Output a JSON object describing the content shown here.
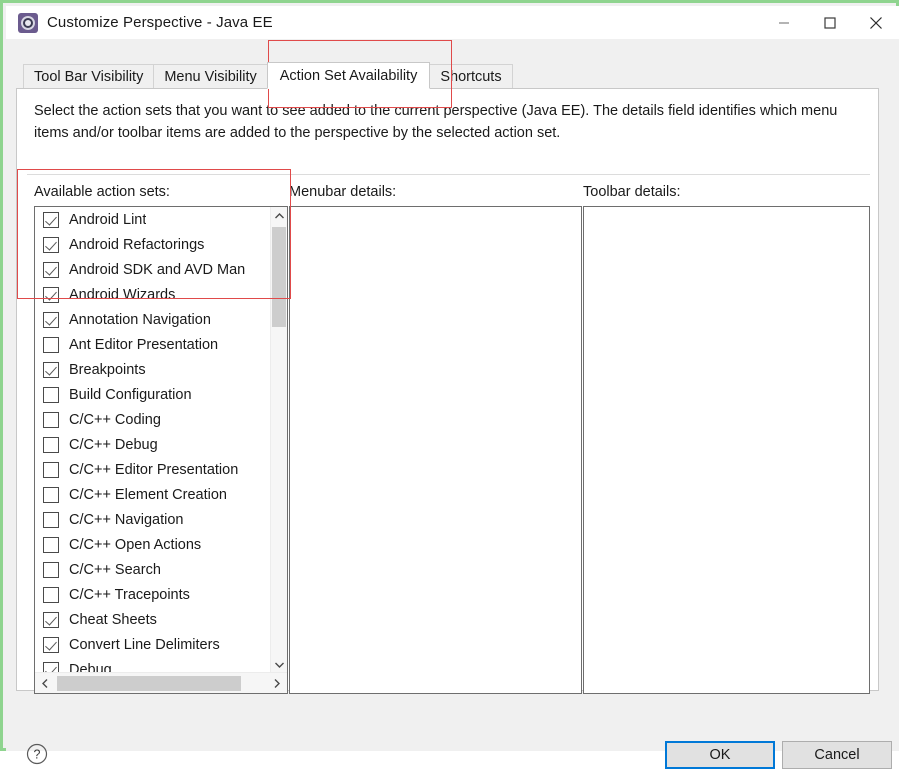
{
  "window": {
    "title": "Customize Perspective - Java EE",
    "icon": "eclipse-perspective-icon",
    "controls": {
      "minimize": "minimize-icon",
      "maximize": "maximize-icon",
      "close": "close-icon"
    },
    "border_color": "#8fd48f"
  },
  "tabs": [
    {
      "label": "Tool Bar Visibility",
      "selected": false
    },
    {
      "label": "Menu Visibility",
      "selected": false
    },
    {
      "label": "Action Set Availability",
      "selected": true
    },
    {
      "label": "Shortcuts",
      "selected": false
    }
  ],
  "description": "Select the action sets that you want to see added to the current perspective (Java EE).  The details field identifies which menu items and/or toolbar items are added to the perspective by the selected action set.",
  "columns": {
    "available": "Available action sets:",
    "menubar": "Menubar details:",
    "toolbar": "Toolbar details:"
  },
  "action_sets": [
    {
      "label": "Android Lint",
      "checked": true
    },
    {
      "label": "Android Refactorings",
      "checked": true
    },
    {
      "label": "Android SDK and AVD Man",
      "checked": true
    },
    {
      "label": "Android Wizards",
      "checked": true
    },
    {
      "label": "Annotation Navigation",
      "checked": true
    },
    {
      "label": "Ant Editor Presentation",
      "checked": false
    },
    {
      "label": "Breakpoints",
      "checked": true
    },
    {
      "label": "Build Configuration",
      "checked": false
    },
    {
      "label": "C/C++ Coding",
      "checked": false
    },
    {
      "label": "C/C++ Debug",
      "checked": false
    },
    {
      "label": "C/C++ Editor Presentation",
      "checked": false
    },
    {
      "label": "C/C++ Element Creation",
      "checked": false
    },
    {
      "label": "C/C++ Navigation",
      "checked": false
    },
    {
      "label": "C/C++ Open Actions",
      "checked": false
    },
    {
      "label": "C/C++ Search",
      "checked": false
    },
    {
      "label": "C/C++ Tracepoints",
      "checked": false
    },
    {
      "label": "Cheat Sheets",
      "checked": true
    },
    {
      "label": "Convert Line Delimiters",
      "checked": true
    },
    {
      "label": "Debug",
      "checked": true
    }
  ],
  "menubar_details": [],
  "toolbar_details": [],
  "scrollbars": {
    "vertical_up": "chevron-up-icon",
    "vertical_down": "chevron-down-icon",
    "horizontal_left": "chevron-left-icon",
    "horizontal_right": "chevron-right-icon"
  },
  "footer": {
    "help": "?",
    "ok_label": "OK",
    "cancel_label": "Cancel",
    "focus_color": "#0078d7"
  },
  "annotations": {
    "color": "#e04a4a",
    "boxes": [
      "action-set-availability-tab",
      "checked-android-action-sets"
    ]
  }
}
